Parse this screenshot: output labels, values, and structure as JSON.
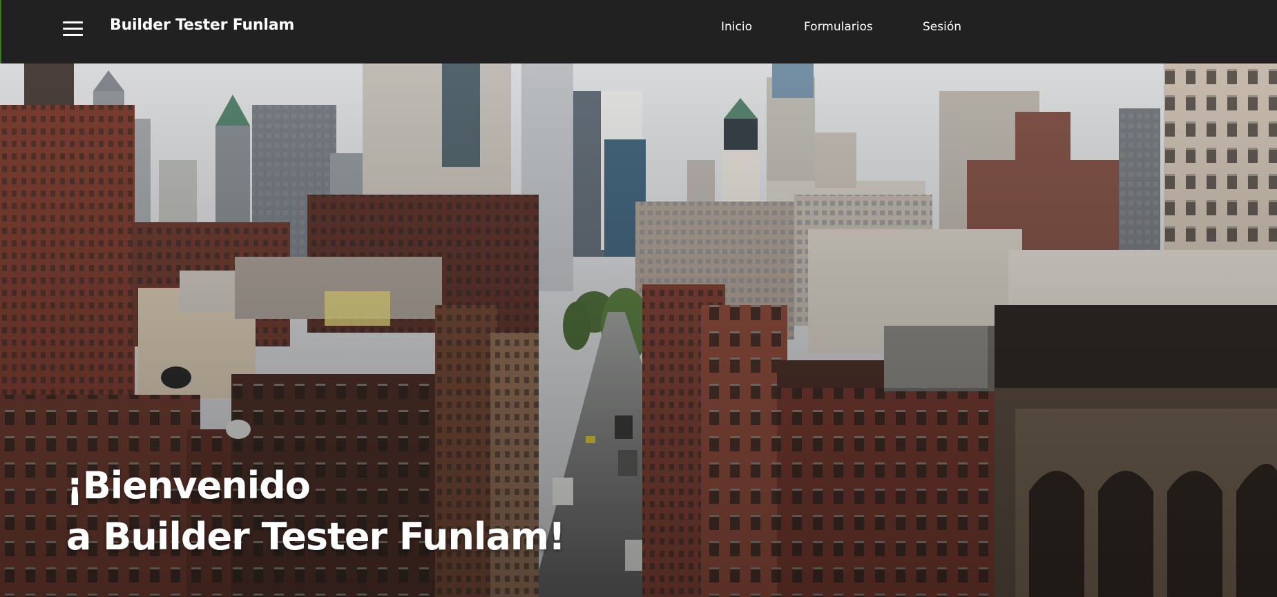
{
  "navbar": {
    "menu_icon": "hamburger-menu-icon",
    "brand": "Builder Tester Funlam",
    "links": [
      {
        "label": "Inicio"
      },
      {
        "label": "Formularios"
      },
      {
        "label": "Sesión"
      }
    ]
  },
  "hero": {
    "title_line1": "¡Bienvenido",
    "title_line2": "a Builder Tester Funlam!",
    "image_subject": "city-street-skyline-photo"
  },
  "colors": {
    "navbar_bg": "#212121",
    "text": "#ffffff",
    "accent_edge": "#3a7d1c"
  }
}
